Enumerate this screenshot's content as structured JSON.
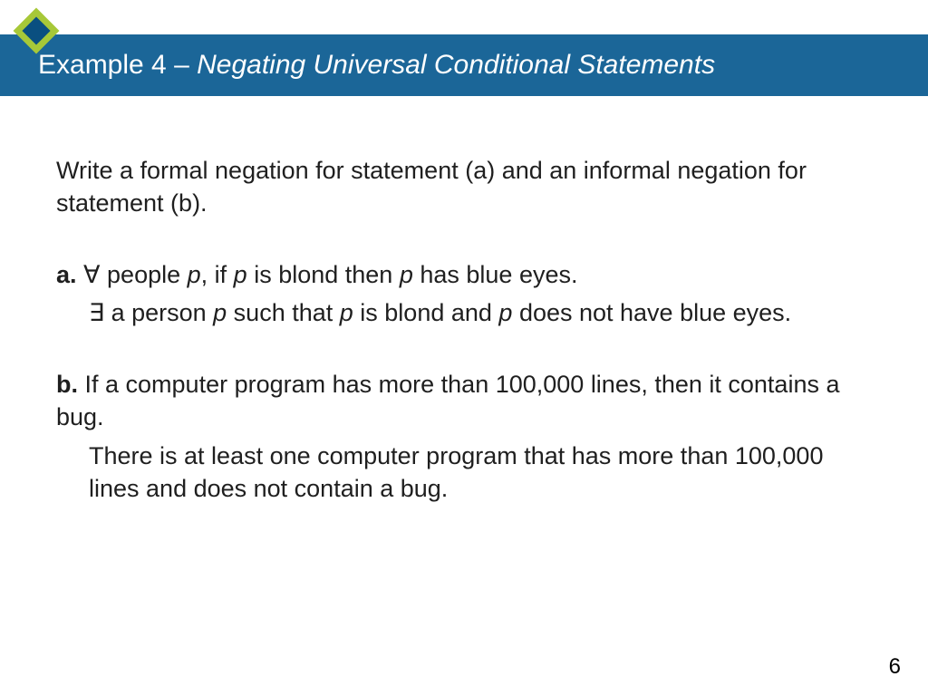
{
  "header": {
    "prefix": "Example 4 – ",
    "italic": "Negating Universal Conditional Statements"
  },
  "intro": "Write a formal negation for statement (a) and an informal negation for statement (b).",
  "itemA": {
    "label": "a.",
    "forall": "∀",
    "line1_part1": " people ",
    "p": "p",
    "line1_part2": ", if ",
    "line1_part3": " is blond then ",
    "line1_part4": " has blue eyes.",
    "exists": "∃",
    "line2_part1": " a person ",
    "line2_part2": " such that ",
    "line2_part3": " is blond and ",
    "line2_part4": " does not have blue eyes."
  },
  "itemB": {
    "label": "b.",
    "line1": " If a computer program has more than 100,000 lines, then it contains a bug.",
    "line2": "There is at least one computer program that has more than 100,000 lines and does not contain a bug."
  },
  "pageNumber": "6",
  "colors": {
    "headerBg": "#1b6698",
    "diamondOuter": "#a7c838",
    "diamondInner": "#0a4f80"
  }
}
